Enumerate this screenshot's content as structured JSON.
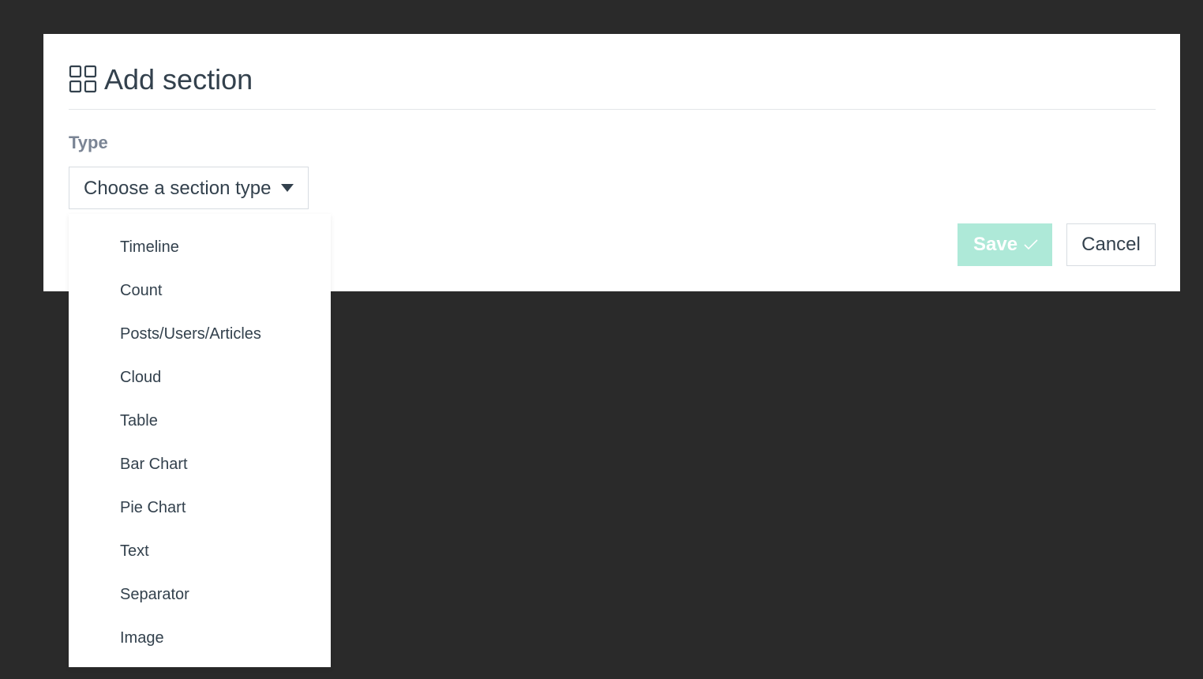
{
  "modal": {
    "title": "Add section",
    "header_icon": "grid-icon"
  },
  "form": {
    "type_label": "Type",
    "type_select": {
      "selected": "Choose a section type",
      "icon": "caret-down-icon"
    }
  },
  "dropdown": {
    "options": [
      "Timeline",
      "Count",
      "Posts/Users/Articles",
      "Cloud",
      "Table",
      "Bar Chart",
      "Pie Chart",
      "Text",
      "Separator",
      "Image"
    ]
  },
  "actions": {
    "save_label": "Save",
    "save_icon": "check-icon",
    "cancel_label": "Cancel"
  },
  "colors": {
    "backdrop": "#2a2a2a",
    "save_button_bg": "#aee9d8",
    "text": "#33414d",
    "label": "#7a8494"
  }
}
